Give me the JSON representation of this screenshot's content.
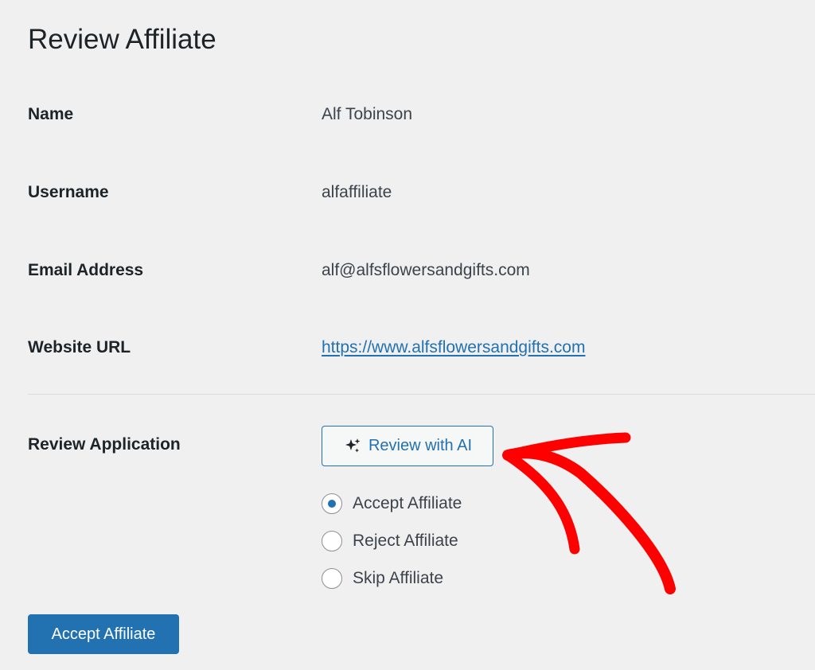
{
  "page": {
    "title": "Review Affiliate"
  },
  "fields": {
    "name": {
      "label": "Name",
      "value": "Alf Tobinson"
    },
    "username": {
      "label": "Username",
      "value": "alfaffiliate"
    },
    "email": {
      "label": "Email Address",
      "value": "alf@alfsflowersandgifts.com"
    },
    "website": {
      "label": "Website URL",
      "value": "https://www.alfsflowersandgifts.com"
    }
  },
  "review": {
    "label": "Review Application",
    "ai_button_label": "Review with AI",
    "ai_button_icon": "sparkle-icon",
    "options": [
      {
        "label": "Accept Affiliate",
        "checked": true
      },
      {
        "label": "Reject Affiliate",
        "checked": false
      },
      {
        "label": "Skip Affiliate",
        "checked": false
      }
    ]
  },
  "submit": {
    "label": "Accept Affiliate"
  },
  "colors": {
    "background": "#f0f0f1",
    "accent": "#2271b1",
    "annotation_arrow": "#ff0000",
    "text": "#1d2327"
  }
}
